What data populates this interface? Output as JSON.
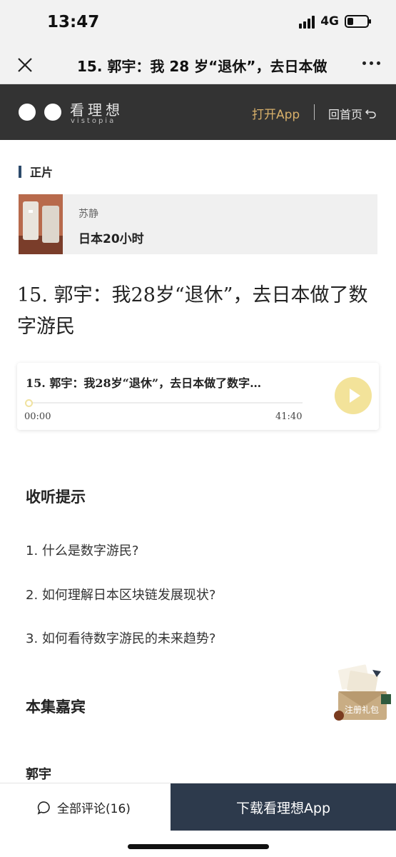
{
  "status": {
    "time": "13:47",
    "network": "4G"
  },
  "nav": {
    "title": "15. 郭宇：我 28 岁“退休”，去日本做"
  },
  "brand": {
    "name": "看理想",
    "subtitle": "vistopia",
    "open_app": "打开App",
    "home": "回首页"
  },
  "section": {
    "label": "正片"
  },
  "album": {
    "author": "苏静",
    "title": "日本20小时"
  },
  "episode": {
    "title": "15. 郭宇：我28岁“退休”，去日本做了数字游民"
  },
  "player": {
    "title": "15. 郭宇：我28岁“退休”，去日本做了数字…",
    "current": "00:00",
    "duration": "41:40",
    "progress": 0
  },
  "tips": {
    "heading": "收听提示",
    "items": [
      "1. 什么是数字游民?",
      "2. 如何理解日本区块链发展现状?",
      "3. 如何看待数字游民的未来趋势?"
    ]
  },
  "guest": {
    "heading": "本集嘉宾",
    "name": "郭宇"
  },
  "gift": {
    "label": "注册礼包"
  },
  "bottom": {
    "comments": "全部评论(16)",
    "download": "下载看理想App"
  },
  "colors": {
    "brand_bg": "#333333",
    "accent_gold": "#d8b06a",
    "play_yellow": "#f3e39a",
    "download_bg": "#2d3a4c"
  }
}
